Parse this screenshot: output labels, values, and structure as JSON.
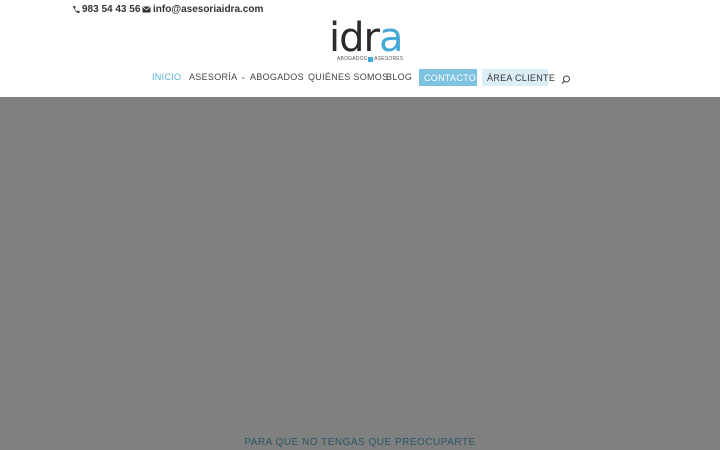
{
  "topbar": {
    "phone": "983 54 43 56",
    "email": "info@asesoriaidra.com",
    "phone_icon": "phone-icon",
    "email_icon": "envelope-icon"
  },
  "logo": {
    "word_dark": "idr",
    "word_blue": "a",
    "tag_left": "ABOGADOS",
    "tag_right": "ASESORES"
  },
  "nav": {
    "items": [
      {
        "label": "INICIO"
      },
      {
        "label": "ASESORÍA"
      },
      {
        "label": "ABOGADOS"
      },
      {
        "label": "QUIÉNES SOMOS"
      },
      {
        "label": "BLOG"
      }
    ],
    "contacto": "CONTACTO",
    "area_cliente": "ÁREA CLIENTE",
    "search_icon": "search-icon"
  },
  "hero": {
    "tagline": "PARA QUE NO TENGAS QUE PREOCUPARTE"
  },
  "colors": {
    "accent": "#55b0d8",
    "hero_bg": "#808080",
    "contacto_bg": "#7dc3e0",
    "area_bg": "#dbeef7"
  }
}
